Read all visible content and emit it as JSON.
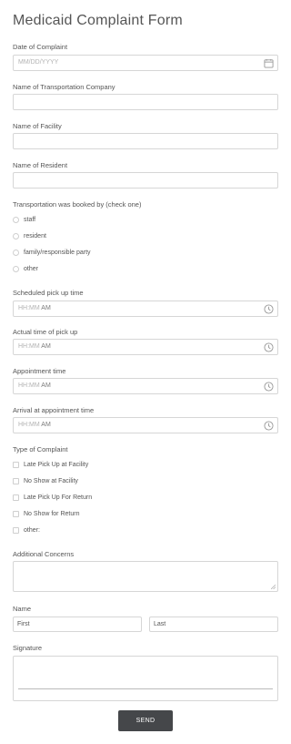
{
  "form": {
    "title": "Medicaid Complaint Form",
    "date_label": "Date of Complaint",
    "date_placeholder": "MM/DD/YYYY",
    "date_icon": "calendar-icon",
    "company_label": "Name of Transportation Company",
    "facility_label": "Name of Facility",
    "resident_label": "Name of Resident",
    "booked_label": "Transportation was booked by (check one)",
    "booked_options": [
      "staff",
      "resident",
      "family/responsible party",
      "other"
    ],
    "time_fields": [
      {
        "label": "Scheduled pick up time",
        "placeholder": "HH:MM",
        "ampm": "AM"
      },
      {
        "label": "Actual time of pick up",
        "placeholder": "HH:MM",
        "ampm": "AM"
      },
      {
        "label": "Appointment time",
        "placeholder": "HH:MM",
        "ampm": "AM"
      },
      {
        "label": "Arrival at appointment time",
        "placeholder": "HH:MM",
        "ampm": "AM"
      }
    ],
    "time_icon": "clock-icon",
    "complaint_label": "Type of Complaint",
    "complaint_options": [
      "Late Pick Up at Facility",
      "No Show at Facility",
      "Late Pick Up For Return",
      "No Show for Return",
      "other:"
    ],
    "concerns_label": "Additional Concerns",
    "name_label": "Name",
    "first_placeholder": "First",
    "last_placeholder": "Last",
    "signature_label": "Signature",
    "send_label": "SEND"
  }
}
